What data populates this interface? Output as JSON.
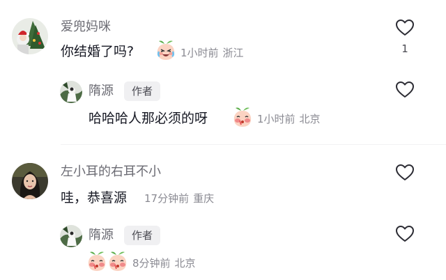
{
  "comments": [
    {
      "username": "爱兜妈咪",
      "text": "你结婚了吗?",
      "time": "1小时前",
      "location": "浙江",
      "likes": "1",
      "emoji_icon": "crying-laughing-peach-emoji",
      "reply": {
        "username": "隋源",
        "author_tag": "作者",
        "text": "哈哈哈人那必须的呀",
        "time": "1小时前",
        "location": "北京",
        "emoji_icon": "blushing-peach-emoji"
      }
    },
    {
      "username": "左小耳的右耳不小",
      "text": "哇，恭喜源",
      "time": "17分钟前",
      "location": "重庆",
      "reply": {
        "username": "隋源",
        "author_tag": "作者",
        "time": "8分钟前",
        "location": "北京",
        "emoji_icon": "blushing-peach-emoji"
      }
    }
  ],
  "colors": {
    "text": "#161823",
    "secondary": "#8a8a92",
    "username": "#6b6b73",
    "tag_bg": "#f0f0f2",
    "peach": "#f6b7a4",
    "peach_leaf": "#5cae4a"
  },
  "icons": {
    "like": "heart-outline-icon"
  }
}
